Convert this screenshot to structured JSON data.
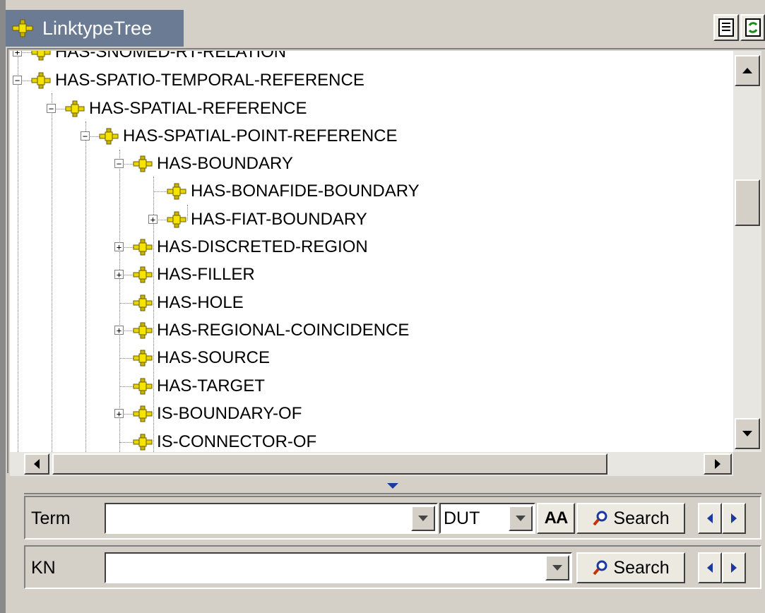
{
  "window": {
    "title": "LinktypeTree",
    "toolbar": [
      {
        "icon": "document-icon"
      },
      {
        "icon": "refresh-icon"
      }
    ]
  },
  "tree": {
    "nodes": [
      {
        "label": "HAS-SNOMED-RT-RELATION",
        "expander": "+"
      },
      {
        "label": "HAS-SPATIO-TEMPORAL-REFERENCE",
        "expander": "-"
      },
      {
        "label": "HAS-SPATIAL-REFERENCE",
        "expander": "-"
      },
      {
        "label": "HAS-SPATIAL-POINT-REFERENCE",
        "expander": "-"
      },
      {
        "label": "HAS-BOUNDARY",
        "expander": "-"
      },
      {
        "label": "HAS-BONAFIDE-BOUNDARY",
        "expander": ""
      },
      {
        "label": "HAS-FIAT-BOUNDARY",
        "expander": "+"
      },
      {
        "label": "HAS-DISCRETED-REGION",
        "expander": "+"
      },
      {
        "label": "HAS-FILLER",
        "expander": "+"
      },
      {
        "label": "HAS-HOLE",
        "expander": ""
      },
      {
        "label": "HAS-REGIONAL-COINCIDENCE",
        "expander": "+"
      },
      {
        "label": "HAS-SOURCE",
        "expander": ""
      },
      {
        "label": "HAS-TARGET",
        "expander": ""
      },
      {
        "label": "IS-BOUNDARY-OF",
        "expander": "+"
      },
      {
        "label": "IS-CONNECTOR-OF",
        "expander": ""
      }
    ]
  },
  "term_row": {
    "label": "Term",
    "value": "",
    "language": "DUT",
    "case_button": "AA",
    "search_label": "Search"
  },
  "kn_row": {
    "label": "KN",
    "value": "",
    "search_label": "Search"
  },
  "colors": {
    "title_tab": "#6b7b93",
    "node_icon": "#e8d400",
    "nav_arrow": "#1a3aa0"
  }
}
